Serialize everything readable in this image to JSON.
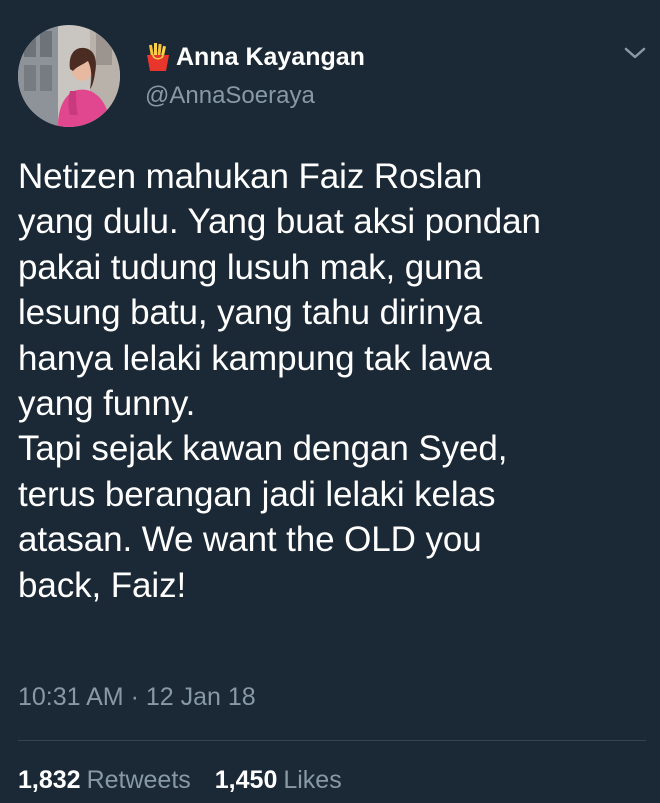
{
  "tweet": {
    "author": {
      "display_name": "Anna Kayangan",
      "handle": "@AnnaSoeraya",
      "name_emoji_icon": "french-fries-icon"
    },
    "menu_icon": "chevron-down-icon",
    "text_lines": [
      "Netizen mahukan Faiz Roslan",
      "yang dulu. Yang buat aksi pondan",
      "pakai tudung lusuh mak, guna",
      "lesung batu, yang tahu dirinya",
      "hanya lelaki kampung tak lawa",
      "yang funny.",
      "Tapi sejak kawan dengan Syed,",
      "terus berangan jadi lelaki kelas",
      "atasan. We want the OLD you",
      "back, Faiz!"
    ],
    "timestamp": "10:31 AM · 12 Jan 18",
    "stats": {
      "retweets_count": "1,832",
      "retweets_label": "Retweets",
      "likes_count": "1,450",
      "likes_label": "Likes"
    }
  },
  "colors": {
    "background": "#1b2836",
    "primary_text": "#ffffff",
    "secondary_text": "#8899a6",
    "divider": "#38444d"
  }
}
